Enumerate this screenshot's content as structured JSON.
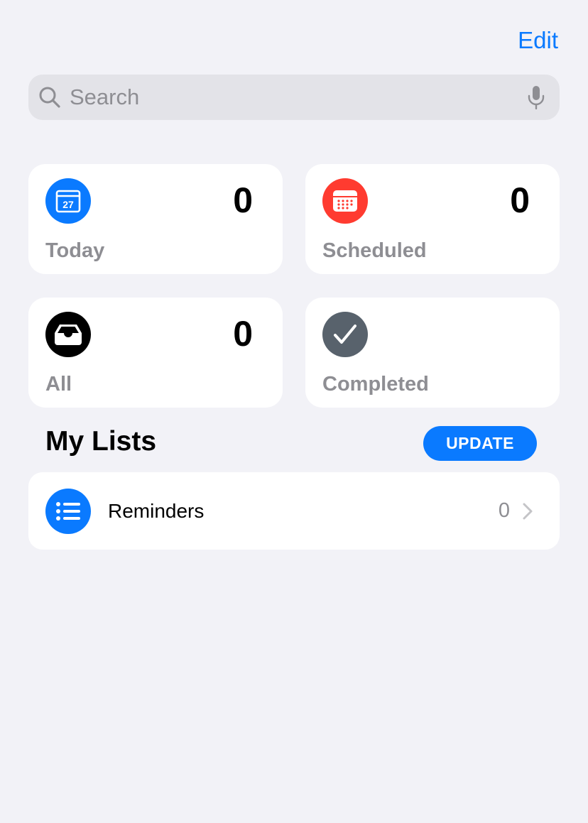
{
  "header": {
    "edit_label": "Edit"
  },
  "search": {
    "placeholder": "Search",
    "value": ""
  },
  "smart_lists": {
    "today": {
      "label": "Today",
      "count": "0",
      "icon": "calendar-today-icon",
      "icon_text": "27",
      "color": "#0A7AFF"
    },
    "scheduled": {
      "label": "Scheduled",
      "count": "0",
      "icon": "calendar-grid-icon",
      "color": "#FF3B30"
    },
    "all": {
      "label": "All",
      "count": "0",
      "icon": "tray-icon",
      "color": "#000000"
    },
    "completed": {
      "label": "Completed",
      "icon": "checkmark-icon",
      "color": "#58626C"
    }
  },
  "my_lists": {
    "title": "My Lists",
    "update_label": "UPDATE",
    "items": [
      {
        "name": "Reminders",
        "count": "0",
        "icon": "list-bullet-icon",
        "color": "#0A7AFF"
      }
    ]
  }
}
